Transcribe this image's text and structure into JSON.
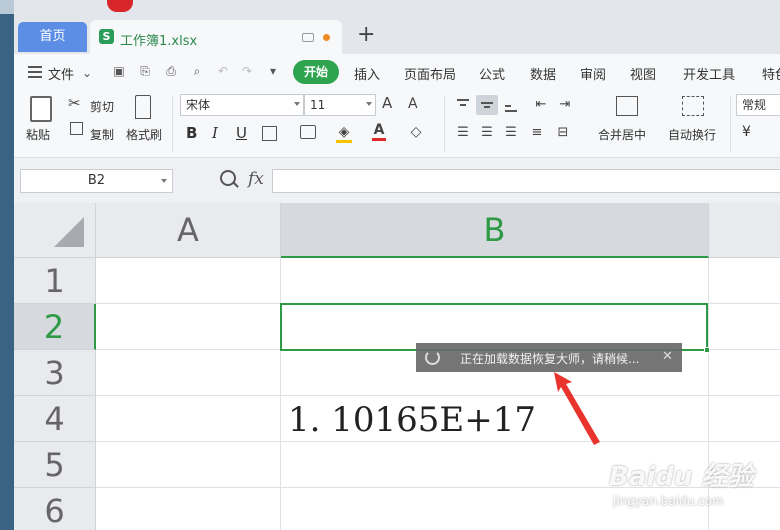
{
  "tabs": {
    "home": "首页",
    "doc_title": "工作簿1.xlsx",
    "doc_icon_letter": "S",
    "add": "+"
  },
  "menu": {
    "file": "文件",
    "start": "开始",
    "items": [
      "插入",
      "页面布局",
      "公式",
      "数据",
      "审阅",
      "视图",
      "开发工具",
      "特色"
    ]
  },
  "ribbon": {
    "paste": "粘贴",
    "cut": "剪切",
    "copy": "复制",
    "format_painter": "格式刷",
    "font_name": "宋体",
    "font_size": "11",
    "bold": "B",
    "italic": "I",
    "underline": "U",
    "merge_center": "合并居中",
    "wrap_text": "自动换行",
    "number_format": "常规",
    "currency": "¥"
  },
  "formula_bar": {
    "name_box": "B2",
    "fx": "fx",
    "formula": ""
  },
  "grid": {
    "columns": [
      "A",
      "B"
    ],
    "rows": [
      "1",
      "2",
      "3",
      "4",
      "5",
      "6"
    ],
    "active_cell": "B2",
    "cell_b4": "1. 10165E+17"
  },
  "toast": {
    "message": "正在加载数据恢复大师，请稍候...",
    "close": "✕"
  },
  "watermark": {
    "logo": "Baidu 经验",
    "url": "jingyan.baidu.com"
  },
  "colors": {
    "accent_green": "#2e9a45",
    "home_tab_blue": "#5c8ee6",
    "annotation_red": "#e8342c"
  }
}
